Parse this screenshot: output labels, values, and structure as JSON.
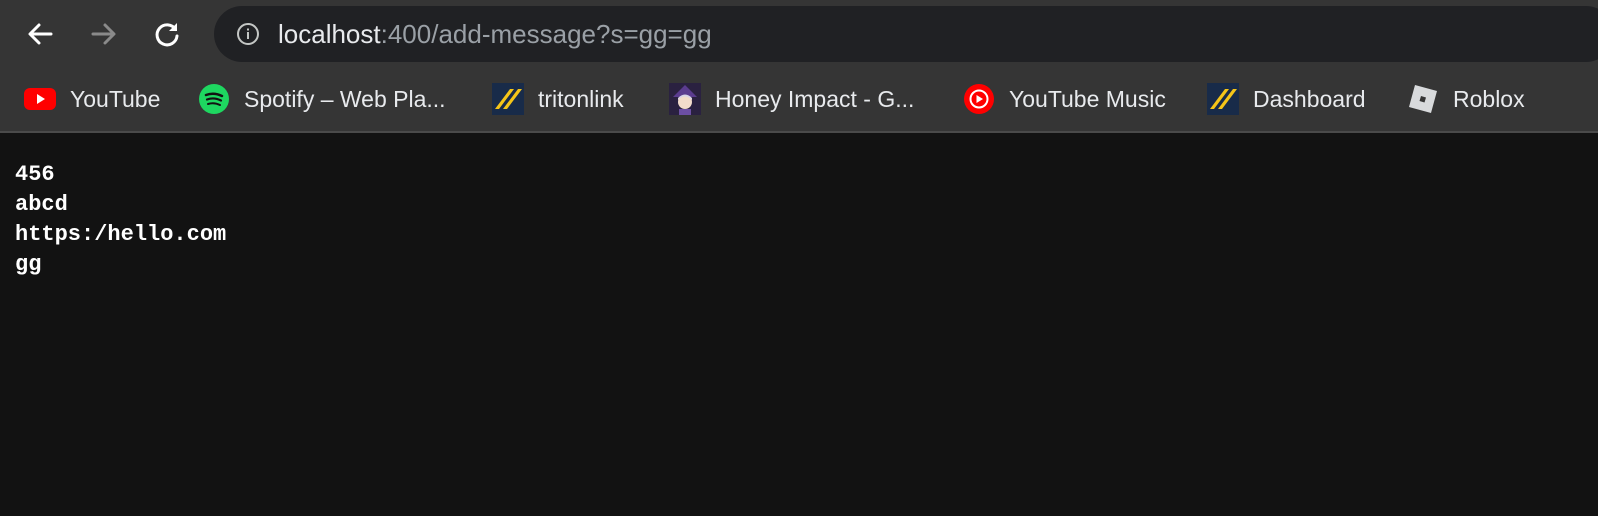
{
  "browser": {
    "nav": {
      "back": "back-arrow-icon",
      "forward": "forward-arrow-icon",
      "reload": "reload-icon"
    },
    "address_bar": {
      "host": "localhost",
      "rest": ":400/add-message?s=gg=gg",
      "icon": "info-icon"
    },
    "bookmarks": [
      {
        "label": "YouTube",
        "icon": "youtube-icon"
      },
      {
        "label": "Spotify – Web Pla...",
        "icon": "spotify-icon"
      },
      {
        "label": "tritonlink",
        "icon": "tritonlink-icon"
      },
      {
        "label": "Honey Impact - G...",
        "icon": "honey-impact-icon"
      },
      {
        "label": "YouTube Music",
        "icon": "youtube-music-icon"
      },
      {
        "label": "Dashboard",
        "icon": "dashboard-icon"
      },
      {
        "label": "Roblox",
        "icon": "roblox-icon"
      }
    ]
  },
  "page": {
    "lines": [
      "456",
      "abcd",
      "https:/hello.com",
      "gg"
    ]
  },
  "colors": {
    "toolbar": "#353535",
    "omnibox": "#202124",
    "page_background": "#121212",
    "youtube_red": "#ff0000",
    "spotify_green": "#1ed760",
    "tritonlink_yellow": "#f5c518"
  }
}
